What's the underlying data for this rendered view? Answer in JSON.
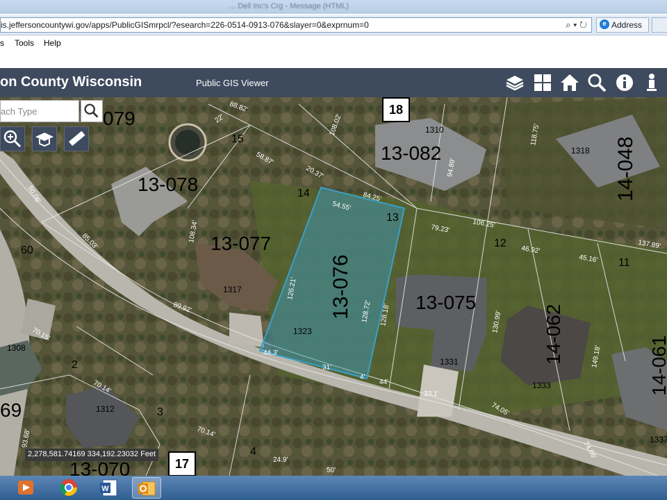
{
  "browser": {
    "window_title": "... Dell Inc's Crg - Message (HTML)",
    "url": "is.jeffersoncountywi.gov/apps/PublicGISmrpcl/?esearch=226-0514-0913-076&slayer=0&exprnum=0",
    "tab_label": "Address ...",
    "menu": [
      "s",
      "Tools",
      "Help"
    ]
  },
  "header": {
    "title": "on County Wisconsin",
    "subtitle": "Public GIS Viewer",
    "buttons": [
      "layers-icon",
      "grid-icon",
      "home-icon",
      "search-icon",
      "info-icon",
      "person-icon"
    ]
  },
  "search": {
    "placeholder": "ach Type"
  },
  "tools": [
    "zoom-in-icon",
    "graduation-cap-icon",
    "ruler-icon"
  ],
  "map": {
    "coordinates": "2,278,581.74169 334,192.23032 Feet",
    "tiles": [
      "18",
      "17"
    ],
    "highlighted_parcel": "13-076",
    "parcel_labels": [
      "079",
      "13-078",
      "13-077",
      "13-076",
      "13-082",
      "13-075",
      "14-048",
      "14-062",
      "14-061",
      "13-070",
      "69"
    ],
    "lot_numbers": [
      "15",
      "14",
      "13",
      "12",
      "11",
      "60",
      "2",
      "3",
      "4"
    ],
    "house_numbers": [
      "1310",
      "1318",
      "1317",
      "1323",
      "1331",
      "1333",
      "1308",
      "1312",
      "1337"
    ],
    "dimensions": [
      "88.82'",
      "22'",
      "108.02'",
      "58.87'",
      "20.37'",
      "94.89'",
      "84.25'",
      "54.55'",
      "79.23'",
      "106.25'",
      "50.06'",
      "85.03'",
      "108.34'",
      "126.21'",
      "128.72'",
      "89.92'",
      "44.3'",
      "31'",
      "4'",
      "128.18'",
      "44'",
      "33.1'",
      "46.92'",
      "45.16'",
      "137.89'",
      "130.99'",
      "74.05'",
      "149.18'",
      "70.14'",
      "70.15'",
      "70.14'",
      "24.9'",
      "93.68'",
      "74.06'",
      "118.75'",
      "50'"
    ]
  },
  "taskbar": [
    "media-player-icon",
    "chrome-icon",
    "word-icon",
    "outlook-icon"
  ],
  "colors": {
    "header_bg": "#3e4a5e",
    "parcel_highlight": "#3aa0c8",
    "taskbar": "#2f5e91"
  }
}
